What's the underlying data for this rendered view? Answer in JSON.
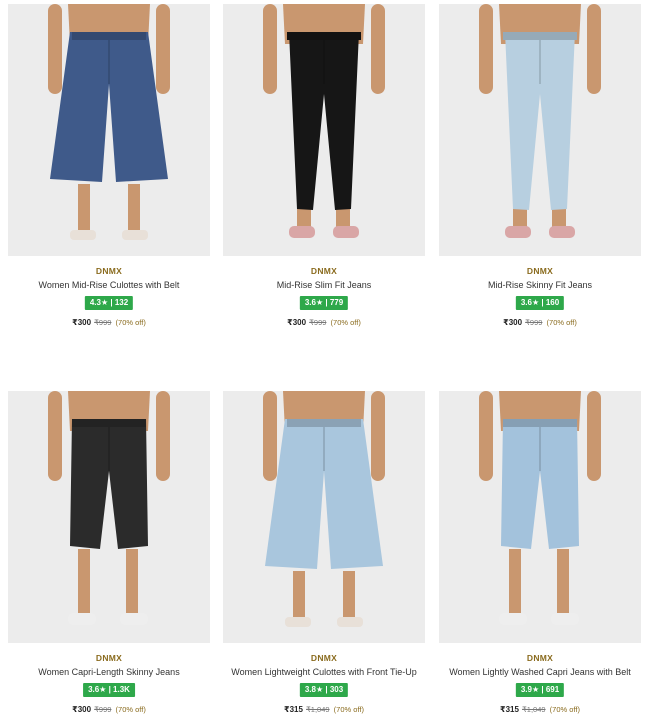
{
  "products": [
    {
      "brand": "DNMX",
      "name": "Women Mid-Rise Culottes with Belt",
      "rating": "4.3★ | 132",
      "price": "₹300",
      "mrp": "₹999",
      "discount": "(70% off)",
      "pants_color": "#3f5a8a",
      "style": "culotte"
    },
    {
      "brand": "DNMX",
      "name": "Mid-Rise Slim Fit Jeans",
      "rating": "3.6★ | 779",
      "price": "₹300",
      "mrp": "₹999",
      "discount": "(70% off)",
      "pants_color": "#161616",
      "style": "slim"
    },
    {
      "brand": "DNMX",
      "name": "Mid-Rise Skinny Fit Jeans",
      "rating": "3.6★ | 160",
      "price": "₹300",
      "mrp": "₹999",
      "discount": "(70% off)",
      "pants_color": "#b7cfe0",
      "style": "skinny"
    },
    {
      "brand": "DNMX",
      "name": "Women Capri-Length Skinny Jeans",
      "rating": "3.6★ | 1.3K",
      "price": "₹300",
      "mrp": "₹999",
      "discount": "(70% off)",
      "pants_color": "#2b2b2b",
      "style": "capri"
    },
    {
      "brand": "DNMX",
      "name": "Women Lightweight Culottes with Front Tie-Up",
      "rating": "3.8★ | 303",
      "price": "₹315",
      "mrp": "₹1,049",
      "discount": "(70% off)",
      "pants_color": "#a9c6dd",
      "style": "culotte"
    },
    {
      "brand": "DNMX",
      "name": "Women Lightly Washed Capri Jeans with Belt",
      "rating": "3.9★ | 691",
      "price": "₹315",
      "mrp": "₹1,049",
      "discount": "(70% off)",
      "pants_color": "#a3c2dc",
      "style": "capri"
    }
  ],
  "colors": {
    "rating_badge": "#2ea84a",
    "brand_text": "#8a6b1e",
    "image_bg": "#ececec",
    "skin": "#c9976f"
  }
}
